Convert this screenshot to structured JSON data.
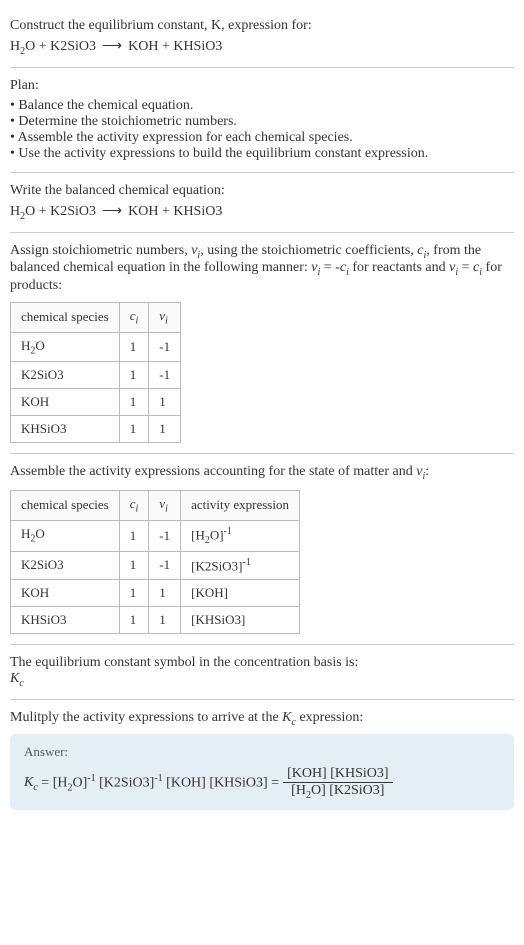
{
  "title_line1": "Construct the equilibrium constant, K, expression for:",
  "main_equation": "H₂O + K2SiO3  ⟶  KOH + KHSiO3",
  "plan_header": "Plan:",
  "plan_items": [
    "Balance the chemical equation.",
    "Determine the stoichiometric numbers.",
    "Assemble the activity expression for each chemical species.",
    "Use the activity expressions to build the equilibrium constant expression."
  ],
  "balanced_header": "Write the balanced chemical equation:",
  "balanced_equation": "H₂O + K2SiO3  ⟶  KOH + KHSiO3",
  "stoich_intro_1": "Assign stoichiometric numbers, νᵢ, using the stoichiometric coefficients, cᵢ, from the balanced chemical equation in the following manner: νᵢ = -cᵢ for reactants and νᵢ = cᵢ for products:",
  "table1_headers": [
    "chemical species",
    "cᵢ",
    "νᵢ"
  ],
  "table1_rows": [
    [
      "H₂O",
      "1",
      "-1"
    ],
    [
      "K2SiO3",
      "1",
      "-1"
    ],
    [
      "KOH",
      "1",
      "1"
    ],
    [
      "KHSiO3",
      "1",
      "1"
    ]
  ],
  "activity_intro": "Assemble the activity expressions accounting for the state of matter and νᵢ:",
  "table2_headers": [
    "chemical species",
    "cᵢ",
    "νᵢ",
    "activity expression"
  ],
  "table2_rows": [
    [
      "H₂O",
      "1",
      "-1",
      "[H₂O]⁻¹"
    ],
    [
      "K2SiO3",
      "1",
      "-1",
      "[K2SiO3]⁻¹"
    ],
    [
      "KOH",
      "1",
      "1",
      "[KOH]"
    ],
    [
      "KHSiO3",
      "1",
      "1",
      "[KHSiO3]"
    ]
  ],
  "symbol_line1": "The equilibrium constant symbol in the concentration basis is:",
  "symbol_line2": "K_c",
  "multiply_line": "Mulitply the activity expressions to arrive at the K_c expression:",
  "answer_label": "Answer:",
  "answer_lhs": "K_c = [H₂O]⁻¹ [K2SiO3]⁻¹ [KOH] [KHSiO3] = ",
  "answer_num": "[KOH] [KHSiO3]",
  "answer_den": "[H₂O] [K2SiO3]"
}
